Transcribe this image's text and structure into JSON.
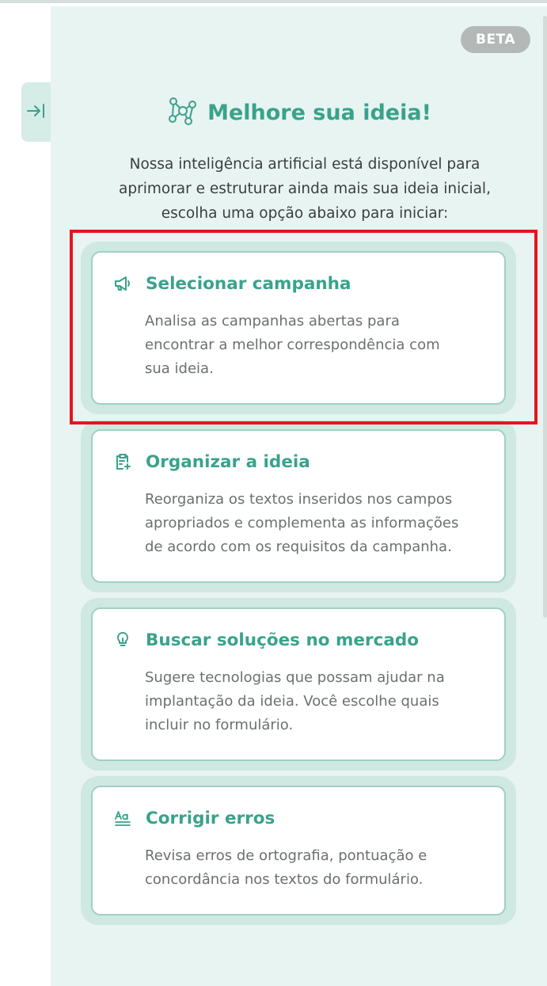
{
  "badge": {
    "label": "BETA"
  },
  "header": {
    "title": "Melhore sua ideia!",
    "icon": "ai-network-icon"
  },
  "intro": {
    "line1": "Nossa inteligência artificial está disponível para",
    "line2": "aprimorar e estruturar ainda mais sua ideia inicial,",
    "line3": "escolha uma opção abaixo para iniciar:"
  },
  "options": [
    {
      "icon": "megaphone-icon",
      "title": "Selecionar campanha",
      "line1": "Analisa as campanhas abertas para",
      "line2": "encontrar a melhor correspondência com",
      "line3": "sua ideia."
    },
    {
      "icon": "clipboard-sparkle-icon",
      "title": "Organizar a ideia",
      "line1": "Reorganiza os textos inseridos nos campos",
      "line2": "apropriados e complementa as informações",
      "line3": "de acordo com os requisitos da campanha."
    },
    {
      "icon": "lightbulb-icon",
      "title": "Buscar soluções no mercado",
      "line1": "Sugere tecnologias que possam ajudar na",
      "line2": "implantação da ideia. Você escolhe quais",
      "line3": "incluir no formulário."
    },
    {
      "icon": "spellcheck-icon",
      "title": "Corrigir erros",
      "line1": "Revisa erros de ortografia, pontuação e",
      "line2": "concordância nos textos do formulário."
    }
  ],
  "colors": {
    "accent": "#3aa28c",
    "panel_bg": "#e8f4f1",
    "card_border": "#9fd0c4",
    "highlight": "#e6141e"
  }
}
